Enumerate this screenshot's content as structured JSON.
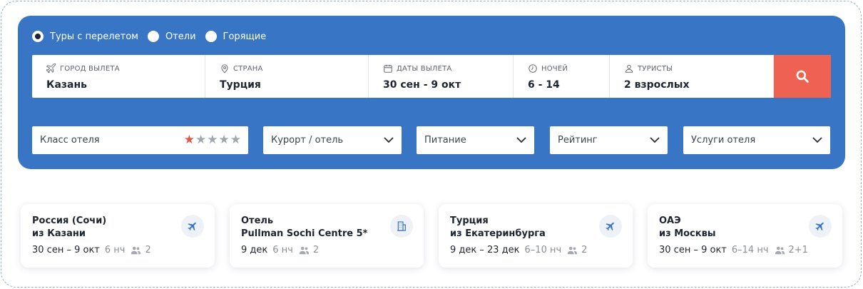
{
  "tour_types": [
    {
      "label": "Туры с перелетом",
      "checked": true
    },
    {
      "label": "Отели",
      "checked": false
    },
    {
      "label": "Горящие",
      "checked": false
    }
  ],
  "fields": {
    "city": {
      "label": "Город вылета",
      "value": "Казань",
      "icon": "plane-icon"
    },
    "country": {
      "label": "Страна",
      "value": "Турция",
      "icon": "location-pin-icon"
    },
    "dates": {
      "label": "Даты вылета",
      "value": "30 сен - 9 окт",
      "icon": "calendar-icon"
    },
    "nights": {
      "label": "Ночей",
      "value": "6 - 14",
      "icon": "clock-icon"
    },
    "tourists": {
      "label": "Туристы",
      "value": "2 взрослых",
      "icon": "person-icon"
    }
  },
  "search_button": {
    "icon": "search-icon",
    "color": "#ef6150"
  },
  "filters": {
    "hotel_class": {
      "label": "Класс отеля",
      "stars_total": 5,
      "stars_selected": 1
    },
    "resort": {
      "label": "Курорт / отель"
    },
    "meals": {
      "label": "Питание"
    },
    "rating": {
      "label": "Рейтинг"
    },
    "services": {
      "label": "Услуги отеля"
    }
  },
  "recent_searches": [
    {
      "title_line1": "Россия (Сочи)",
      "title_line2": "из Казани",
      "dates": "30 сен – 9 окт",
      "nights": "6 нч",
      "tourists": "2",
      "icon": "plane-icon"
    },
    {
      "title_line1": "Отель",
      "title_line2": "Pullman Sochi Centre 5*",
      "dates": "9 дек",
      "nights": "6 нч",
      "tourists": "2",
      "icon": "building-icon"
    },
    {
      "title_line1": "Турция",
      "title_line2": "из Екатеринбурга",
      "dates": "9 дек – 23 дек",
      "nights": "6–10 нч",
      "tourists": "2",
      "icon": "plane-icon"
    },
    {
      "title_line1": "ОАЭ",
      "title_line2": "из Москвы",
      "dates": "30 сен – 9 окт",
      "nights": "6–14 нч",
      "tourists": "2+1",
      "icon": "plane-icon"
    }
  ],
  "colors": {
    "panel": "#3875c5",
    "accent": "#ef6150",
    "star_active": "#e45746",
    "star_inactive": "#a3a7ad"
  }
}
